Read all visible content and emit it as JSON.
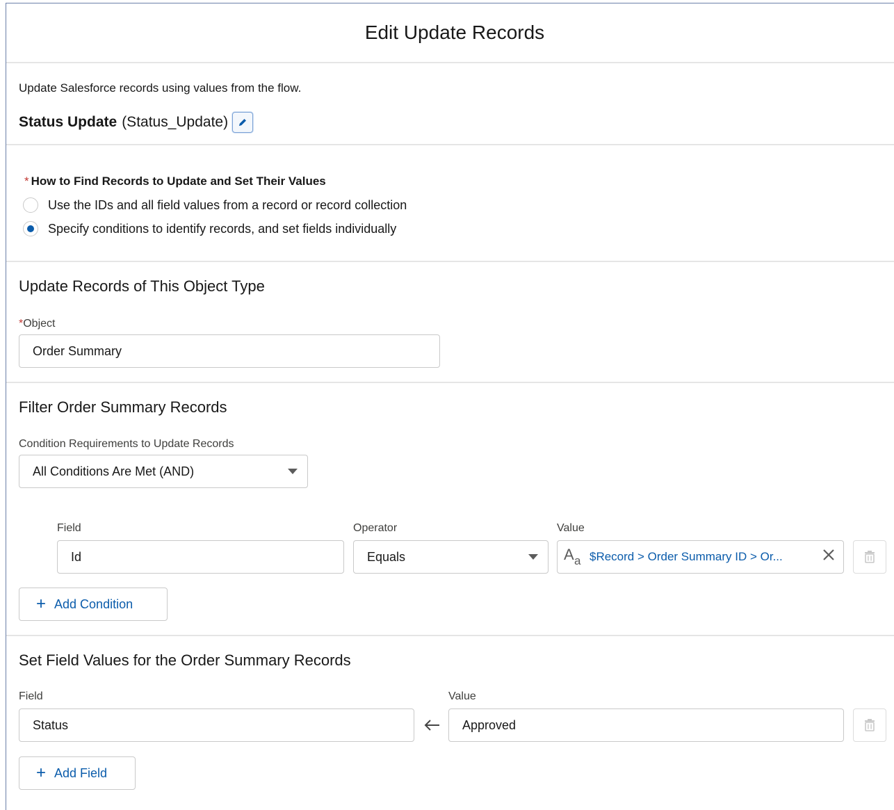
{
  "header": {
    "title": "Edit Update Records"
  },
  "intro": {
    "description": "Update Salesforce records using values from the flow.",
    "element_label": "Status Update",
    "element_api": "(Status_Update)"
  },
  "find": {
    "required_mark": "*",
    "label": "How to Find Records to Update and Set Their Values",
    "options": [
      {
        "label": "Use the IDs and all field values from a record or record collection",
        "selected": false
      },
      {
        "label": "Specify conditions to identify records, and set fields individually",
        "selected": true
      }
    ]
  },
  "object_section": {
    "heading": "Update Records of This Object Type",
    "required_mark": "*",
    "object_label": "Object",
    "object_value": "Order Summary"
  },
  "filter_section": {
    "heading": "Filter Order Summary Records",
    "requirement_label": "Condition Requirements to Update Records",
    "requirement_value": "All Conditions Are Met (AND)",
    "condition": {
      "field_label": "Field",
      "field_value": "Id",
      "operator_label": "Operator",
      "operator_value": "Equals",
      "value_label": "Value",
      "value_text": "$Record > Order Summary ID > Or..."
    },
    "add_condition_label": "Add Condition"
  },
  "set_section": {
    "heading": "Set Field Values for the Order Summary Records",
    "field_label": "Field",
    "field_value": "Status",
    "value_label": "Value",
    "value_value": "Approved",
    "add_field_label": "Add Field"
  },
  "colors": {
    "brand": "#0b5cab",
    "required": "#c23934",
    "border": "#c9c9c9"
  }
}
